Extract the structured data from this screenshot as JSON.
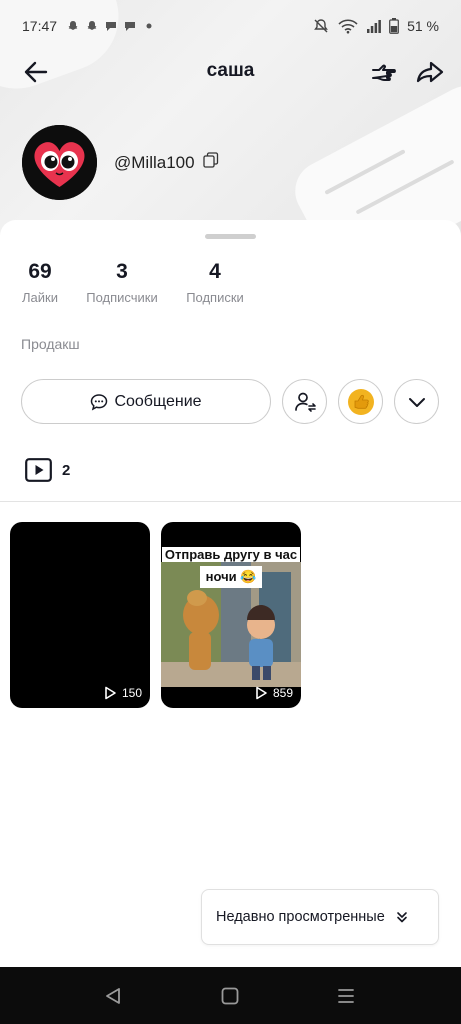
{
  "status_bar": {
    "time": "17:47",
    "battery": "51 %",
    "left_icons": [
      "snapchat-icon",
      "snapchat-icon",
      "chat-bubble-icon",
      "chat-bubble-icon",
      "dot-icon"
    ],
    "right_icons": [
      "mute-icon",
      "wifi-icon",
      "signal-icon",
      "battery-icon"
    ]
  },
  "nav": {
    "title": "саша"
  },
  "profile": {
    "username": "@Milla100",
    "bio": "Продакш"
  },
  "stats": [
    {
      "value": "69",
      "label": "Лайки"
    },
    {
      "value": "3",
      "label": "Подписчики"
    },
    {
      "value": "4",
      "label": "Подписки"
    }
  ],
  "actions": {
    "message_label": "Сообщение"
  },
  "videos": {
    "count": "2",
    "items": [
      {
        "views": "150",
        "caption_line1": "",
        "caption_line2": ""
      },
      {
        "views": "859",
        "caption_line1": "Отправь другу в час",
        "caption_line2": "ночи 😂"
      }
    ]
  },
  "recent": {
    "label": "Недавно просмотренные"
  },
  "colors": {
    "text_primary": "#161823",
    "text_secondary": "#8a8b91",
    "border": "#cccccc",
    "nav_bar": "#0c0c0c"
  }
}
